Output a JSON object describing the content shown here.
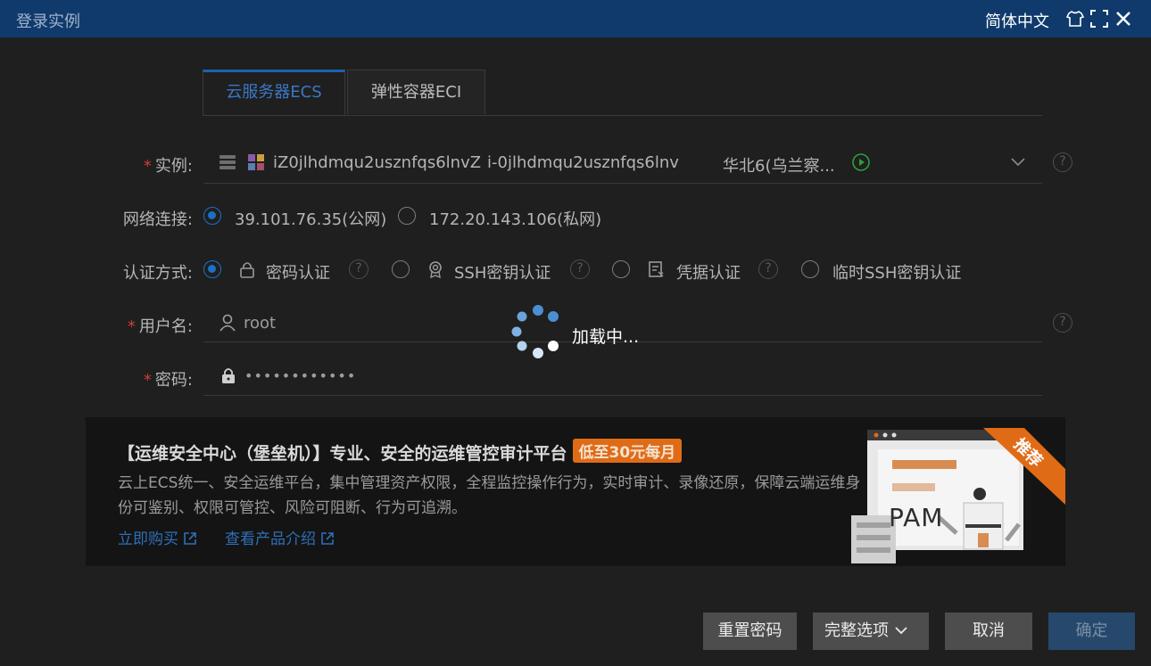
{
  "window": {
    "title": "登录实例",
    "language": "简体中文"
  },
  "tabs": [
    {
      "label": "云服务器ECS",
      "active": true
    },
    {
      "label": "弹性容器ECI",
      "active": false
    }
  ],
  "form": {
    "instance": {
      "label": "实例:",
      "required": true,
      "name": "iZ0jlhdmqu2usznfqs6lnvZ",
      "id": "i-0jlhdmqu2usznfqs6lnv",
      "region": "华北6(乌兰察..."
    },
    "network": {
      "label": "网络连接:",
      "options": [
        {
          "label": "39.101.76.35(公网)",
          "selected": true
        },
        {
          "label": "172.20.143.106(私网)",
          "selected": false
        }
      ]
    },
    "auth": {
      "label": "认证方式:",
      "options": [
        {
          "label": "密码认证",
          "selected": true
        },
        {
          "label": "SSH密钥认证",
          "selected": false
        },
        {
          "label": "凭据认证",
          "selected": false
        },
        {
          "label": "临时SSH密钥认证",
          "selected": false
        }
      ]
    },
    "username": {
      "label": "用户名:",
      "required": true,
      "value": "root"
    },
    "password": {
      "label": "密码:",
      "required": true,
      "value": "••••••••••••"
    }
  },
  "loading": {
    "text": "加载中..."
  },
  "banner": {
    "title": "【运维安全中心（堡垒机）】专业、安全的运维管控审计平台",
    "tag": "低至30元每月",
    "description": "云上ECS统一、安全运维平台，集中管理资产权限，全程监控操作行为，实时审计、录像还原，保障云端运维身份可鉴别、权限可管控、风险可阻断、行为可追溯。",
    "buy_link": "立即购买",
    "intro_link": "查看产品介绍",
    "ribbon": "推荐",
    "illustration_text": "PAM"
  },
  "buttons": {
    "reset_password": "重置密码",
    "full_options": "完整选项",
    "cancel": "取消",
    "confirm": "确定"
  },
  "colors": {
    "title_bar": "#0f3a6b",
    "accent": "#1f6fc5",
    "orange": "#e06b17",
    "required": "#d23b3b"
  }
}
